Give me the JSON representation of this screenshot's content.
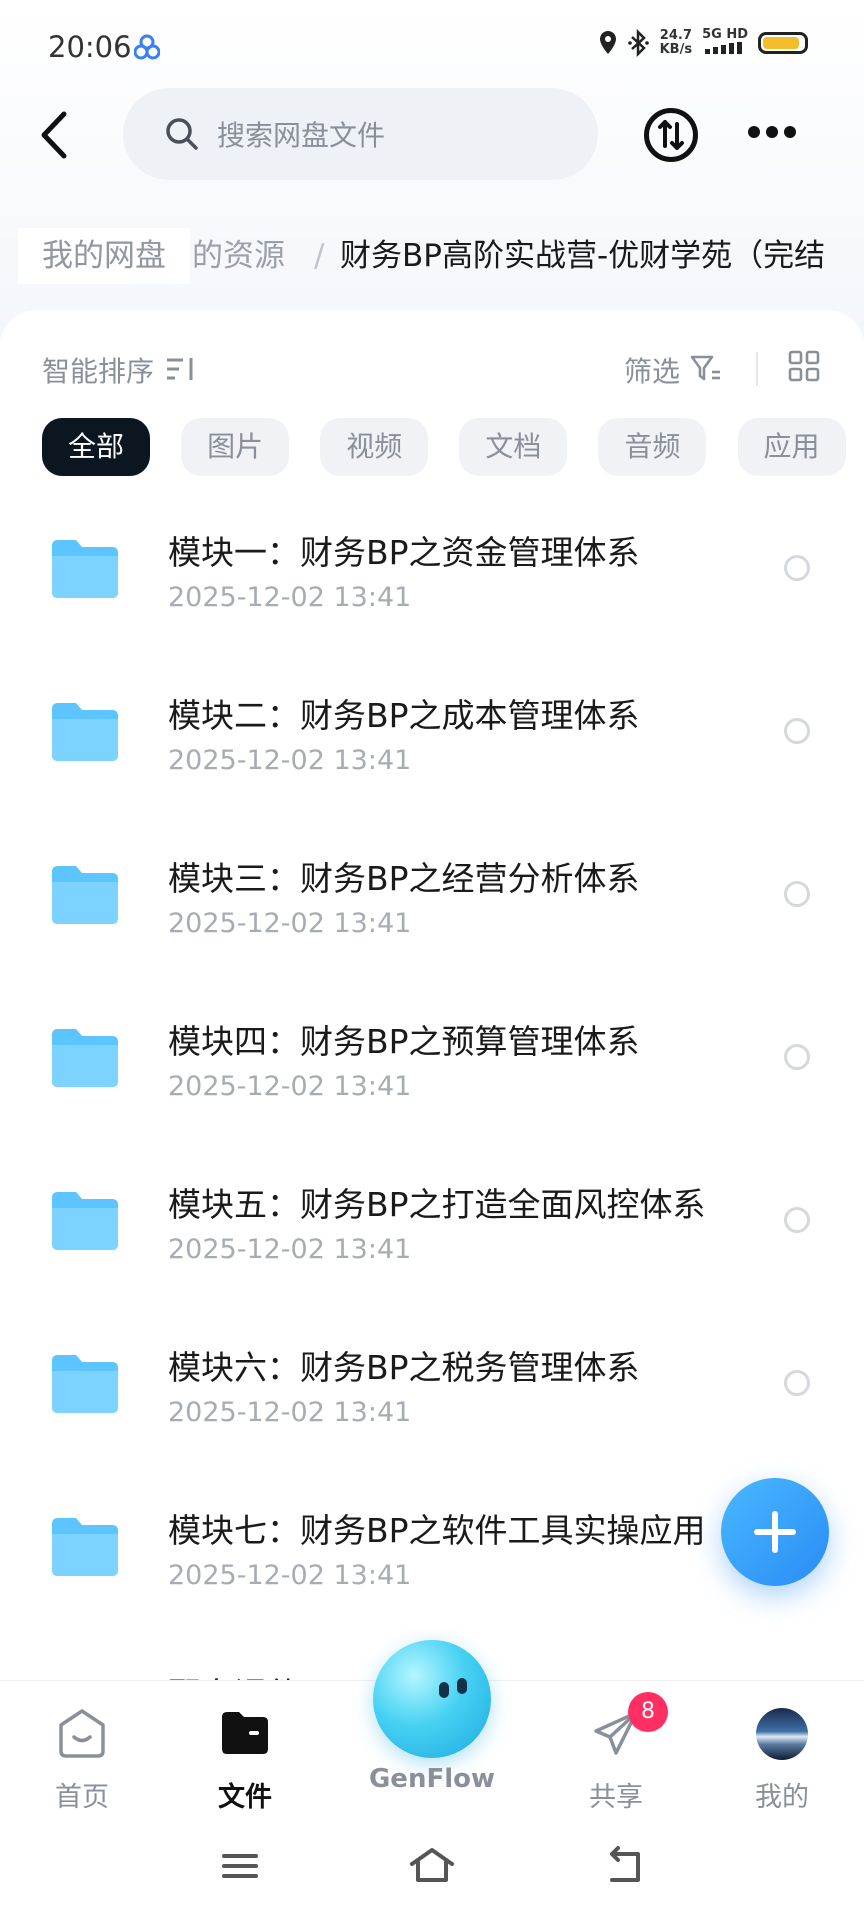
{
  "status_bar": {
    "time": "20:06",
    "net_speed": "24.7",
    "net_unit": "KB/s",
    "network": "5G HD"
  },
  "header": {
    "search_placeholder": "搜索网盘文件"
  },
  "breadcrumb": {
    "root": "我的网盘",
    "middle": "的资源",
    "separator": "/",
    "current": "财务BP高阶实战营-优财学苑（完结"
  },
  "toolbar": {
    "sort_label": "智能排序",
    "filter_label": "筛选"
  },
  "chips": [
    "全部",
    "图片",
    "视频",
    "文档",
    "音频",
    "应用"
  ],
  "files": [
    {
      "name": "模块一：财务BP之资金管理体系",
      "date": "2025-12-02  13:41"
    },
    {
      "name": "模块二：财务BP之成本管理体系",
      "date": "2025-12-02  13:41"
    },
    {
      "name": "模块三：财务BP之经营分析体系",
      "date": "2025-12-02  13:41"
    },
    {
      "name": "模块四：财务BP之预算管理体系",
      "date": "2025-12-02  13:41"
    },
    {
      "name": "模块五：财务BP之打造全面风控体系",
      "date": "2025-12-02  13:41"
    },
    {
      "name": "模块六：财务BP之税务管理体系",
      "date": "2025-12-02  13:41"
    },
    {
      "name": "模块七：财务BP之软件工具实操应用",
      "date": "2025-12-02  13:41"
    }
  ],
  "partial_row": "配套课件",
  "bottom_nav": {
    "home": "首页",
    "files": "文件",
    "genflow": "GenFlow",
    "share": "共享",
    "share_badge": "8",
    "mine": "我的"
  },
  "colors": {
    "accent": "#2a8cf5",
    "folder": "#5cc4ff",
    "badge": "#ff2e63",
    "active_chip": "#0c1620"
  }
}
